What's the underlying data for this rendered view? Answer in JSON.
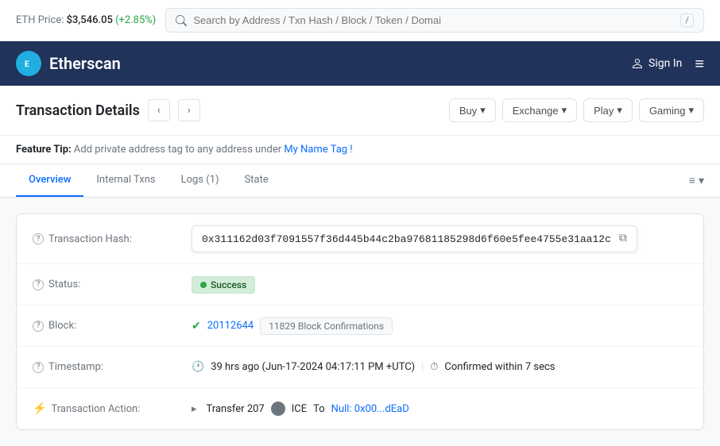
{
  "topbar": {
    "eth_label": "ETH Price:",
    "eth_price": "$3,546.05",
    "eth_change": "(+2.85%)",
    "search_placeholder": "Search by Address / Txn Hash / Block / Token / Domai",
    "slash_key": "/"
  },
  "navbar": {
    "brand_name": "Etherscan",
    "brand_initial": "E",
    "sign_in_label": "Sign In",
    "hamburger_icon": "≡"
  },
  "page": {
    "title": "Transaction Details",
    "prev_icon": "‹",
    "next_icon": "›"
  },
  "header_buttons": [
    {
      "label": "Buy",
      "icon": "▾"
    },
    {
      "label": "Exchange",
      "icon": "▾"
    },
    {
      "label": "Play",
      "icon": "▾"
    },
    {
      "label": "Gaming",
      "icon": "▾"
    }
  ],
  "feature_tip": {
    "prefix": "Feature Tip:",
    "text": " Add private address tag to any address under ",
    "link_text": "My Name Tag !",
    "link_href": "#"
  },
  "tabs": [
    {
      "label": "Overview",
      "active": true
    },
    {
      "label": "Internal Txns",
      "active": false
    },
    {
      "label": "Logs (1)",
      "active": false
    },
    {
      "label": "State",
      "active": false
    }
  ],
  "tabs_right_icon": "≡",
  "transaction": {
    "hash": {
      "label": "Transaction Hash:",
      "value": "0x311162d03f7091557f36d445b44c2ba97681185298d6f60e5fee4755e31aa12c",
      "copy_icon": "⧉"
    },
    "status": {
      "label": "Status:",
      "value": "Success"
    },
    "block": {
      "label": "Block:",
      "number": "20112644",
      "confirmations": "11829 Block Confirmations"
    },
    "timestamp": {
      "label": "Timestamp:",
      "time_ago": "39 hrs ago (Jun-17-2024 04:17:11 PM +UTC)",
      "pipe": "|",
      "confirm_text": "Confirmed within 7 secs"
    },
    "action": {
      "label": "Transaction Action:",
      "arrow": "▸",
      "transfer_text": "Transfer 207",
      "token_label": "ICE",
      "to_text": "To",
      "null_link": "Null: 0x00...dEaD"
    }
  }
}
